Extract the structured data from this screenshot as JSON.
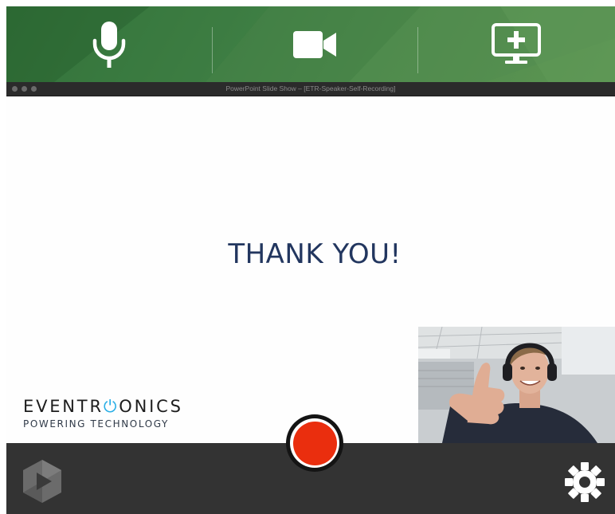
{
  "toolbar": {
    "buttons": [
      {
        "name": "microphone",
        "icon": "microphone-icon"
      },
      {
        "name": "camera",
        "icon": "video-camera-icon"
      },
      {
        "name": "add-screen",
        "icon": "monitor-plus-icon"
      }
    ],
    "color": "#3f7f44"
  },
  "window": {
    "title": "PowerPoint Slide Show – [ETR-Speaker-Self-Recording]"
  },
  "slide": {
    "title": "THANK YOU!",
    "logo": {
      "word_part1": "EVENT",
      "word_part2": "R",
      "word_part3": "ONICS",
      "tagline": "POWERING TECHNOLOGY",
      "accent_color": "#28aee6"
    }
  },
  "webcam": {
    "subject": "person wearing headphones giving a thumbs up"
  },
  "controls": {
    "record_color": "#ea2e0e",
    "logo_icon": "panopto-logo-icon",
    "settings_icon": "gear-icon"
  }
}
